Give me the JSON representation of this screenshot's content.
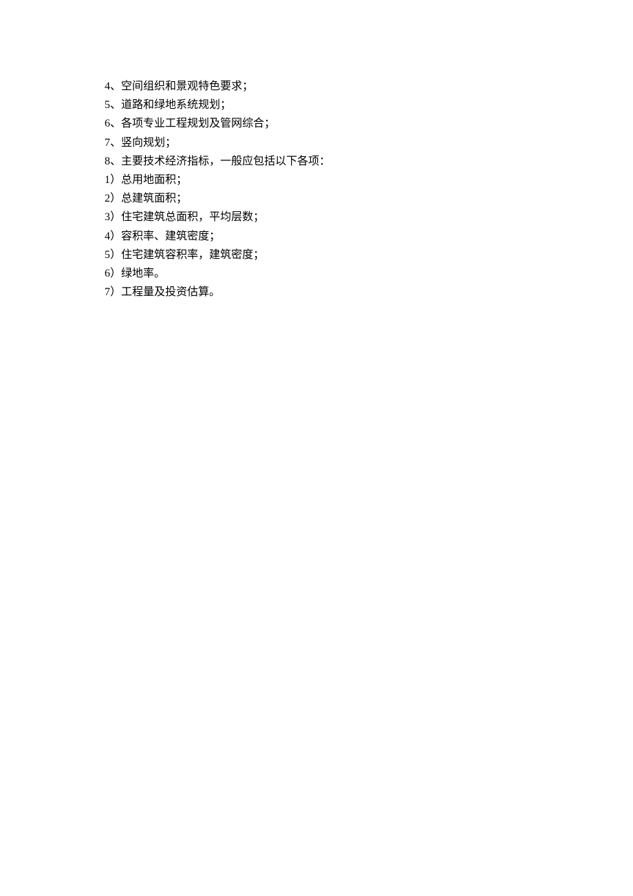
{
  "lines": [
    "4、空间组织和景观特色要求；",
    "5、道路和绿地系统规划；",
    "6、各项专业工程规划及管网综合；",
    "7、竖向规划；",
    "8、主要技术经济指标，一般应包括以下各项：",
    "1）总用地面积；",
    "2）总建筑面积；",
    "3）住宅建筑总面积，平均层数；",
    "4）容积率、建筑密度；",
    "5）住宅建筑容积率，建筑密度；",
    "6）绿地率。",
    "7）工程量及投资估算。"
  ]
}
